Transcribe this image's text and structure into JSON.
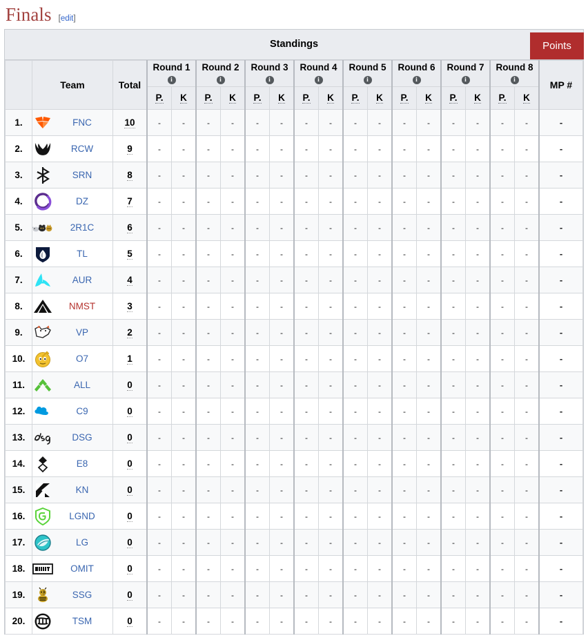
{
  "page": {
    "title": "Finals",
    "edit_label": "edit",
    "edit_open": "[",
    "edit_close": "]"
  },
  "panel": {
    "title": "Standings",
    "points_button": "Points",
    "accent_color": "#b02d2d",
    "header_bg": "#eaecf0",
    "link_color": "#3a66b0",
    "redlink_color": "#b5342f"
  },
  "table": {
    "headers": {
      "rank": "",
      "team": "Team",
      "total": "Total",
      "mp": "MP #"
    },
    "rounds": [
      {
        "label": "Round 1",
        "info": "i",
        "p": "P.",
        "k": "K"
      },
      {
        "label": "Round 2",
        "info": "i",
        "p": "P.",
        "k": "K"
      },
      {
        "label": "Round 3",
        "info": "i",
        "p": "P.",
        "k": "K"
      },
      {
        "label": "Round 4",
        "info": "i",
        "p": "P.",
        "k": "K"
      },
      {
        "label": "Round 5",
        "info": "i",
        "p": "P.",
        "k": "K"
      },
      {
        "label": "Round 6",
        "info": "i",
        "p": "P.",
        "k": "K"
      },
      {
        "label": "Round 7",
        "info": "i",
        "p": "P.",
        "k": "K"
      },
      {
        "label": "Round 8",
        "info": "i",
        "p": "P.",
        "k": "K"
      }
    ],
    "empty_value": "-",
    "rows": [
      {
        "rank": "1.",
        "team": "FNC",
        "total": "10",
        "redlink": false,
        "logo": "fnatic-logo",
        "values": [
          "-",
          "-",
          "-",
          "-",
          "-",
          "-",
          "-",
          "-",
          "-",
          "-",
          "-",
          "-",
          "-",
          "-",
          "-",
          "-"
        ],
        "mp": "-"
      },
      {
        "rank": "2.",
        "team": "RCW",
        "total": "9",
        "redlink": false,
        "logo": "rcw-logo",
        "values": [
          "-",
          "-",
          "-",
          "-",
          "-",
          "-",
          "-",
          "-",
          "-",
          "-",
          "-",
          "-",
          "-",
          "-",
          "-",
          "-"
        ],
        "mp": "-"
      },
      {
        "rank": "3.",
        "team": "SRN",
        "total": "8",
        "redlink": false,
        "logo": "sprout-rune-logo",
        "values": [
          "-",
          "-",
          "-",
          "-",
          "-",
          "-",
          "-",
          "-",
          "-",
          "-",
          "-",
          "-",
          "-",
          "-",
          "-",
          "-"
        ],
        "mp": "-"
      },
      {
        "rank": "4.",
        "team": "DZ",
        "total": "7",
        "redlink": false,
        "logo": "dz-swirl-logo",
        "values": [
          "-",
          "-",
          "-",
          "-",
          "-",
          "-",
          "-",
          "-",
          "-",
          "-",
          "-",
          "-",
          "-",
          "-",
          "-",
          "-"
        ],
        "mp": "-"
      },
      {
        "rank": "5.",
        "team": "2R1C",
        "total": "6",
        "redlink": false,
        "logo": "two-rats-one-cat-logo",
        "values": [
          "-",
          "-",
          "-",
          "-",
          "-",
          "-",
          "-",
          "-",
          "-",
          "-",
          "-",
          "-",
          "-",
          "-",
          "-",
          "-"
        ],
        "mp": "-"
      },
      {
        "rank": "6.",
        "team": "TL",
        "total": "5",
        "redlink": false,
        "logo": "team-liquid-logo",
        "values": [
          "-",
          "-",
          "-",
          "-",
          "-",
          "-",
          "-",
          "-",
          "-",
          "-",
          "-",
          "-",
          "-",
          "-",
          "-",
          "-"
        ],
        "mp": "-"
      },
      {
        "rank": "7.",
        "team": "AUR",
        "total": "4",
        "redlink": false,
        "logo": "aurora-logo",
        "values": [
          "-",
          "-",
          "-",
          "-",
          "-",
          "-",
          "-",
          "-",
          "-",
          "-",
          "-",
          "-",
          "-",
          "-",
          "-",
          "-"
        ],
        "mp": "-"
      },
      {
        "rank": "8.",
        "team": "NMST",
        "total": "3",
        "redlink": true,
        "logo": "nemesis-arrow-logo",
        "values": [
          "-",
          "-",
          "-",
          "-",
          "-",
          "-",
          "-",
          "-",
          "-",
          "-",
          "-",
          "-",
          "-",
          "-",
          "-",
          "-"
        ],
        "mp": "-"
      },
      {
        "rank": "9.",
        "team": "VP",
        "total": "2",
        "redlink": false,
        "logo": "virtus-pro-logo",
        "values": [
          "-",
          "-",
          "-",
          "-",
          "-",
          "-",
          "-",
          "-",
          "-",
          "-",
          "-",
          "-",
          "-",
          "-",
          "-",
          "-"
        ],
        "mp": "-"
      },
      {
        "rank": "10.",
        "team": "O7",
        "total": "1",
        "redlink": false,
        "logo": "o7-smiley-logo",
        "values": [
          "-",
          "-",
          "-",
          "-",
          "-",
          "-",
          "-",
          "-",
          "-",
          "-",
          "-",
          "-",
          "-",
          "-",
          "-",
          "-"
        ],
        "mp": "-"
      },
      {
        "rank": "11.",
        "team": "ALL",
        "total": "0",
        "redlink": false,
        "logo": "alliance-logo",
        "values": [
          "-",
          "-",
          "-",
          "-",
          "-",
          "-",
          "-",
          "-",
          "-",
          "-",
          "-",
          "-",
          "-",
          "-",
          "-",
          "-"
        ],
        "mp": "-"
      },
      {
        "rank": "12.",
        "team": "C9",
        "total": "0",
        "redlink": false,
        "logo": "cloud9-logo",
        "values": [
          "-",
          "-",
          "-",
          "-",
          "-",
          "-",
          "-",
          "-",
          "-",
          "-",
          "-",
          "-",
          "-",
          "-",
          "-",
          "-"
        ],
        "mp": "-"
      },
      {
        "rank": "13.",
        "team": "DSG",
        "total": "0",
        "redlink": false,
        "logo": "dsg-script-logo",
        "values": [
          "-",
          "-",
          "-",
          "-",
          "-",
          "-",
          "-",
          "-",
          "-",
          "-",
          "-",
          "-",
          "-",
          "-",
          "-",
          "-"
        ],
        "mp": "-"
      },
      {
        "rank": "14.",
        "team": "E8",
        "total": "0",
        "redlink": false,
        "logo": "e8-diamond-logo",
        "values": [
          "-",
          "-",
          "-",
          "-",
          "-",
          "-",
          "-",
          "-",
          "-",
          "-",
          "-",
          "-",
          "-",
          "-",
          "-",
          "-"
        ],
        "mp": "-"
      },
      {
        "rank": "15.",
        "team": "KN",
        "total": "0",
        "redlink": false,
        "logo": "kn-logo",
        "values": [
          "-",
          "-",
          "-",
          "-",
          "-",
          "-",
          "-",
          "-",
          "-",
          "-",
          "-",
          "-",
          "-",
          "-",
          "-",
          "-"
        ],
        "mp": "-"
      },
      {
        "rank": "16.",
        "team": "LGND",
        "total": "0",
        "redlink": false,
        "logo": "legend-shield-logo",
        "values": [
          "-",
          "-",
          "-",
          "-",
          "-",
          "-",
          "-",
          "-",
          "-",
          "-",
          "-",
          "-",
          "-",
          "-",
          "-",
          "-"
        ],
        "mp": "-"
      },
      {
        "rank": "17.",
        "team": "LG",
        "total": "0",
        "redlink": false,
        "logo": "lg-orb-logo",
        "values": [
          "-",
          "-",
          "-",
          "-",
          "-",
          "-",
          "-",
          "-",
          "-",
          "-",
          "-",
          "-",
          "-",
          "-",
          "-",
          "-"
        ],
        "mp": "-"
      },
      {
        "rank": "18.",
        "team": "OMIT",
        "total": "0",
        "redlink": false,
        "logo": "omit-box-logo",
        "values": [
          "-",
          "-",
          "-",
          "-",
          "-",
          "-",
          "-",
          "-",
          "-",
          "-",
          "-",
          "-",
          "-",
          "-",
          "-",
          "-"
        ],
        "mp": "-"
      },
      {
        "rank": "19.",
        "team": "SSG",
        "total": "0",
        "redlink": false,
        "logo": "ssg-bee-logo",
        "values": [
          "-",
          "-",
          "-",
          "-",
          "-",
          "-",
          "-",
          "-",
          "-",
          "-",
          "-",
          "-",
          "-",
          "-",
          "-",
          "-"
        ],
        "mp": "-"
      },
      {
        "rank": "20.",
        "team": "TSM",
        "total": "0",
        "redlink": false,
        "logo": "tsm-logo",
        "values": [
          "-",
          "-",
          "-",
          "-",
          "-",
          "-",
          "-",
          "-",
          "-",
          "-",
          "-",
          "-",
          "-",
          "-",
          "-",
          "-"
        ],
        "mp": "-"
      }
    ]
  }
}
